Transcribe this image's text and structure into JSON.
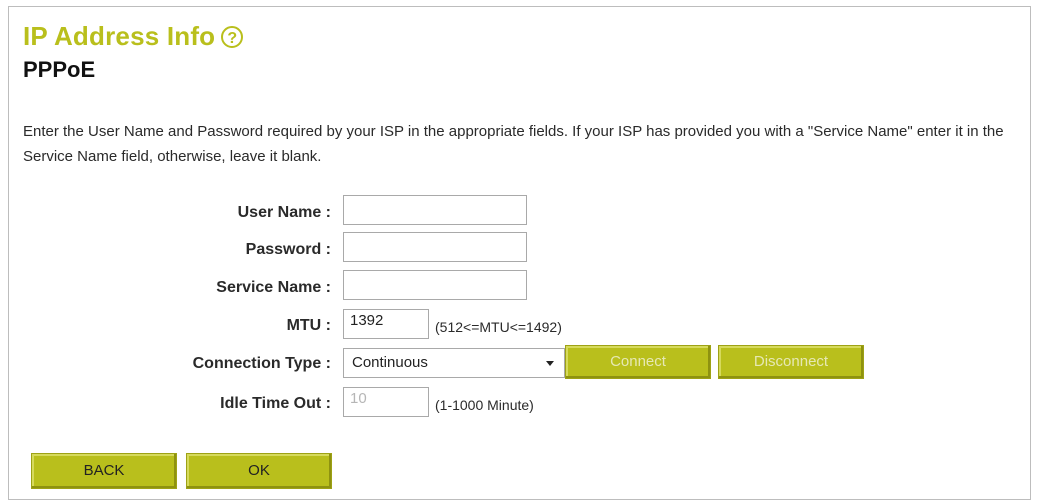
{
  "header": {
    "title": "IP Address Info",
    "help_icon": "question-circle-icon",
    "subtitle": "PPPoE"
  },
  "description": "Enter the User Name and Password required by your ISP in the appropriate fields. If your ISP has provided you with a \"Service Name\" enter it in the Service Name field, otherwise, leave it blank.",
  "form": {
    "user_name": {
      "label": "User Name :",
      "value": ""
    },
    "password": {
      "label": "Password :",
      "value": ""
    },
    "service_name": {
      "label": "Service Name :",
      "value": ""
    },
    "mtu": {
      "label": "MTU :",
      "value": "1392",
      "hint": "(512<=MTU<=1492)"
    },
    "connection_type": {
      "label": "Connection Type :",
      "selected": "Continuous",
      "connect_label": "Connect",
      "disconnect_label": "Disconnect"
    },
    "idle_time_out": {
      "label": "Idle Time Out :",
      "value": "10",
      "hint": "(1-1000 Minute)"
    }
  },
  "actions": {
    "back_label": "BACK",
    "ok_label": "OK"
  },
  "colors": {
    "accent": "#b9bf1c",
    "button_disabled_text": "#e6e8b4"
  }
}
